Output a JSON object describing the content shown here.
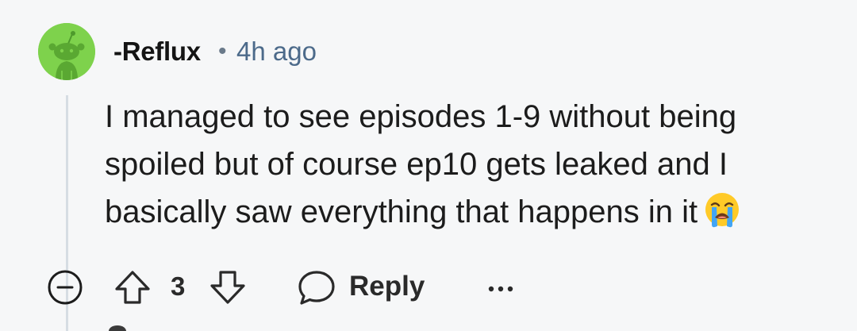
{
  "comment": {
    "author": "-Reflux",
    "separator": "•",
    "timestamp": "4h ago",
    "body": "I managed to see episodes 1-9 without being spoiled but of course ep10 gets leaked and I basically saw everything that happens in it",
    "emoji": "loudly-crying-face"
  },
  "actions": {
    "collapse_icon": "collapse-minus-icon",
    "upvote_icon": "upvote-arrow-icon",
    "vote_count": "3",
    "downvote_icon": "downvote-arrow-icon",
    "reply_icon": "speech-bubble-icon",
    "reply_label": "Reply",
    "more_icon": "more-dots-icon"
  },
  "colors": {
    "background": "#f6f7f8",
    "avatar": "#7ed24c",
    "username": "#141414",
    "timestamp": "#4c6a8a",
    "thread_line": "#d6dde3"
  }
}
